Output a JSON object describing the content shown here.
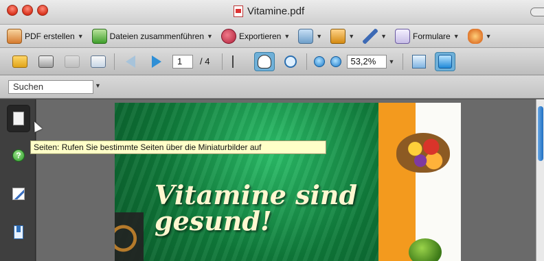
{
  "window": {
    "title": "Vitamine.pdf"
  },
  "task_toolbar": {
    "create_pdf_label": "PDF erstellen",
    "combine_files_label": "Dateien zusammenführen",
    "export_label": "Exportieren",
    "forms_label": "Formulare"
  },
  "main_toolbar": {
    "current_page": "1",
    "page_total": "/ 4",
    "zoom_value": "53,2%"
  },
  "find": {
    "search_placeholder": "Suchen"
  },
  "tooltip": {
    "text": "Seiten: Rufen Sie bestimmte Seiten über die Miniaturbilder auf"
  },
  "document": {
    "headline": "Vitamine sind gesund!"
  },
  "icons": {
    "create_pdf": "create-pdf-icon",
    "combine": "combine-files-icon",
    "export": "export-icon",
    "sign": "sign-icon",
    "secure": "lock-icon",
    "pen": "pen-icon",
    "forms": "forms-icon",
    "review": "review-icon"
  },
  "colors": {
    "accent": "#6fb0d8",
    "tooltip_bg": "#ffffc8",
    "document_green": "#0f7a3a",
    "document_orange": "#f39a1e"
  }
}
